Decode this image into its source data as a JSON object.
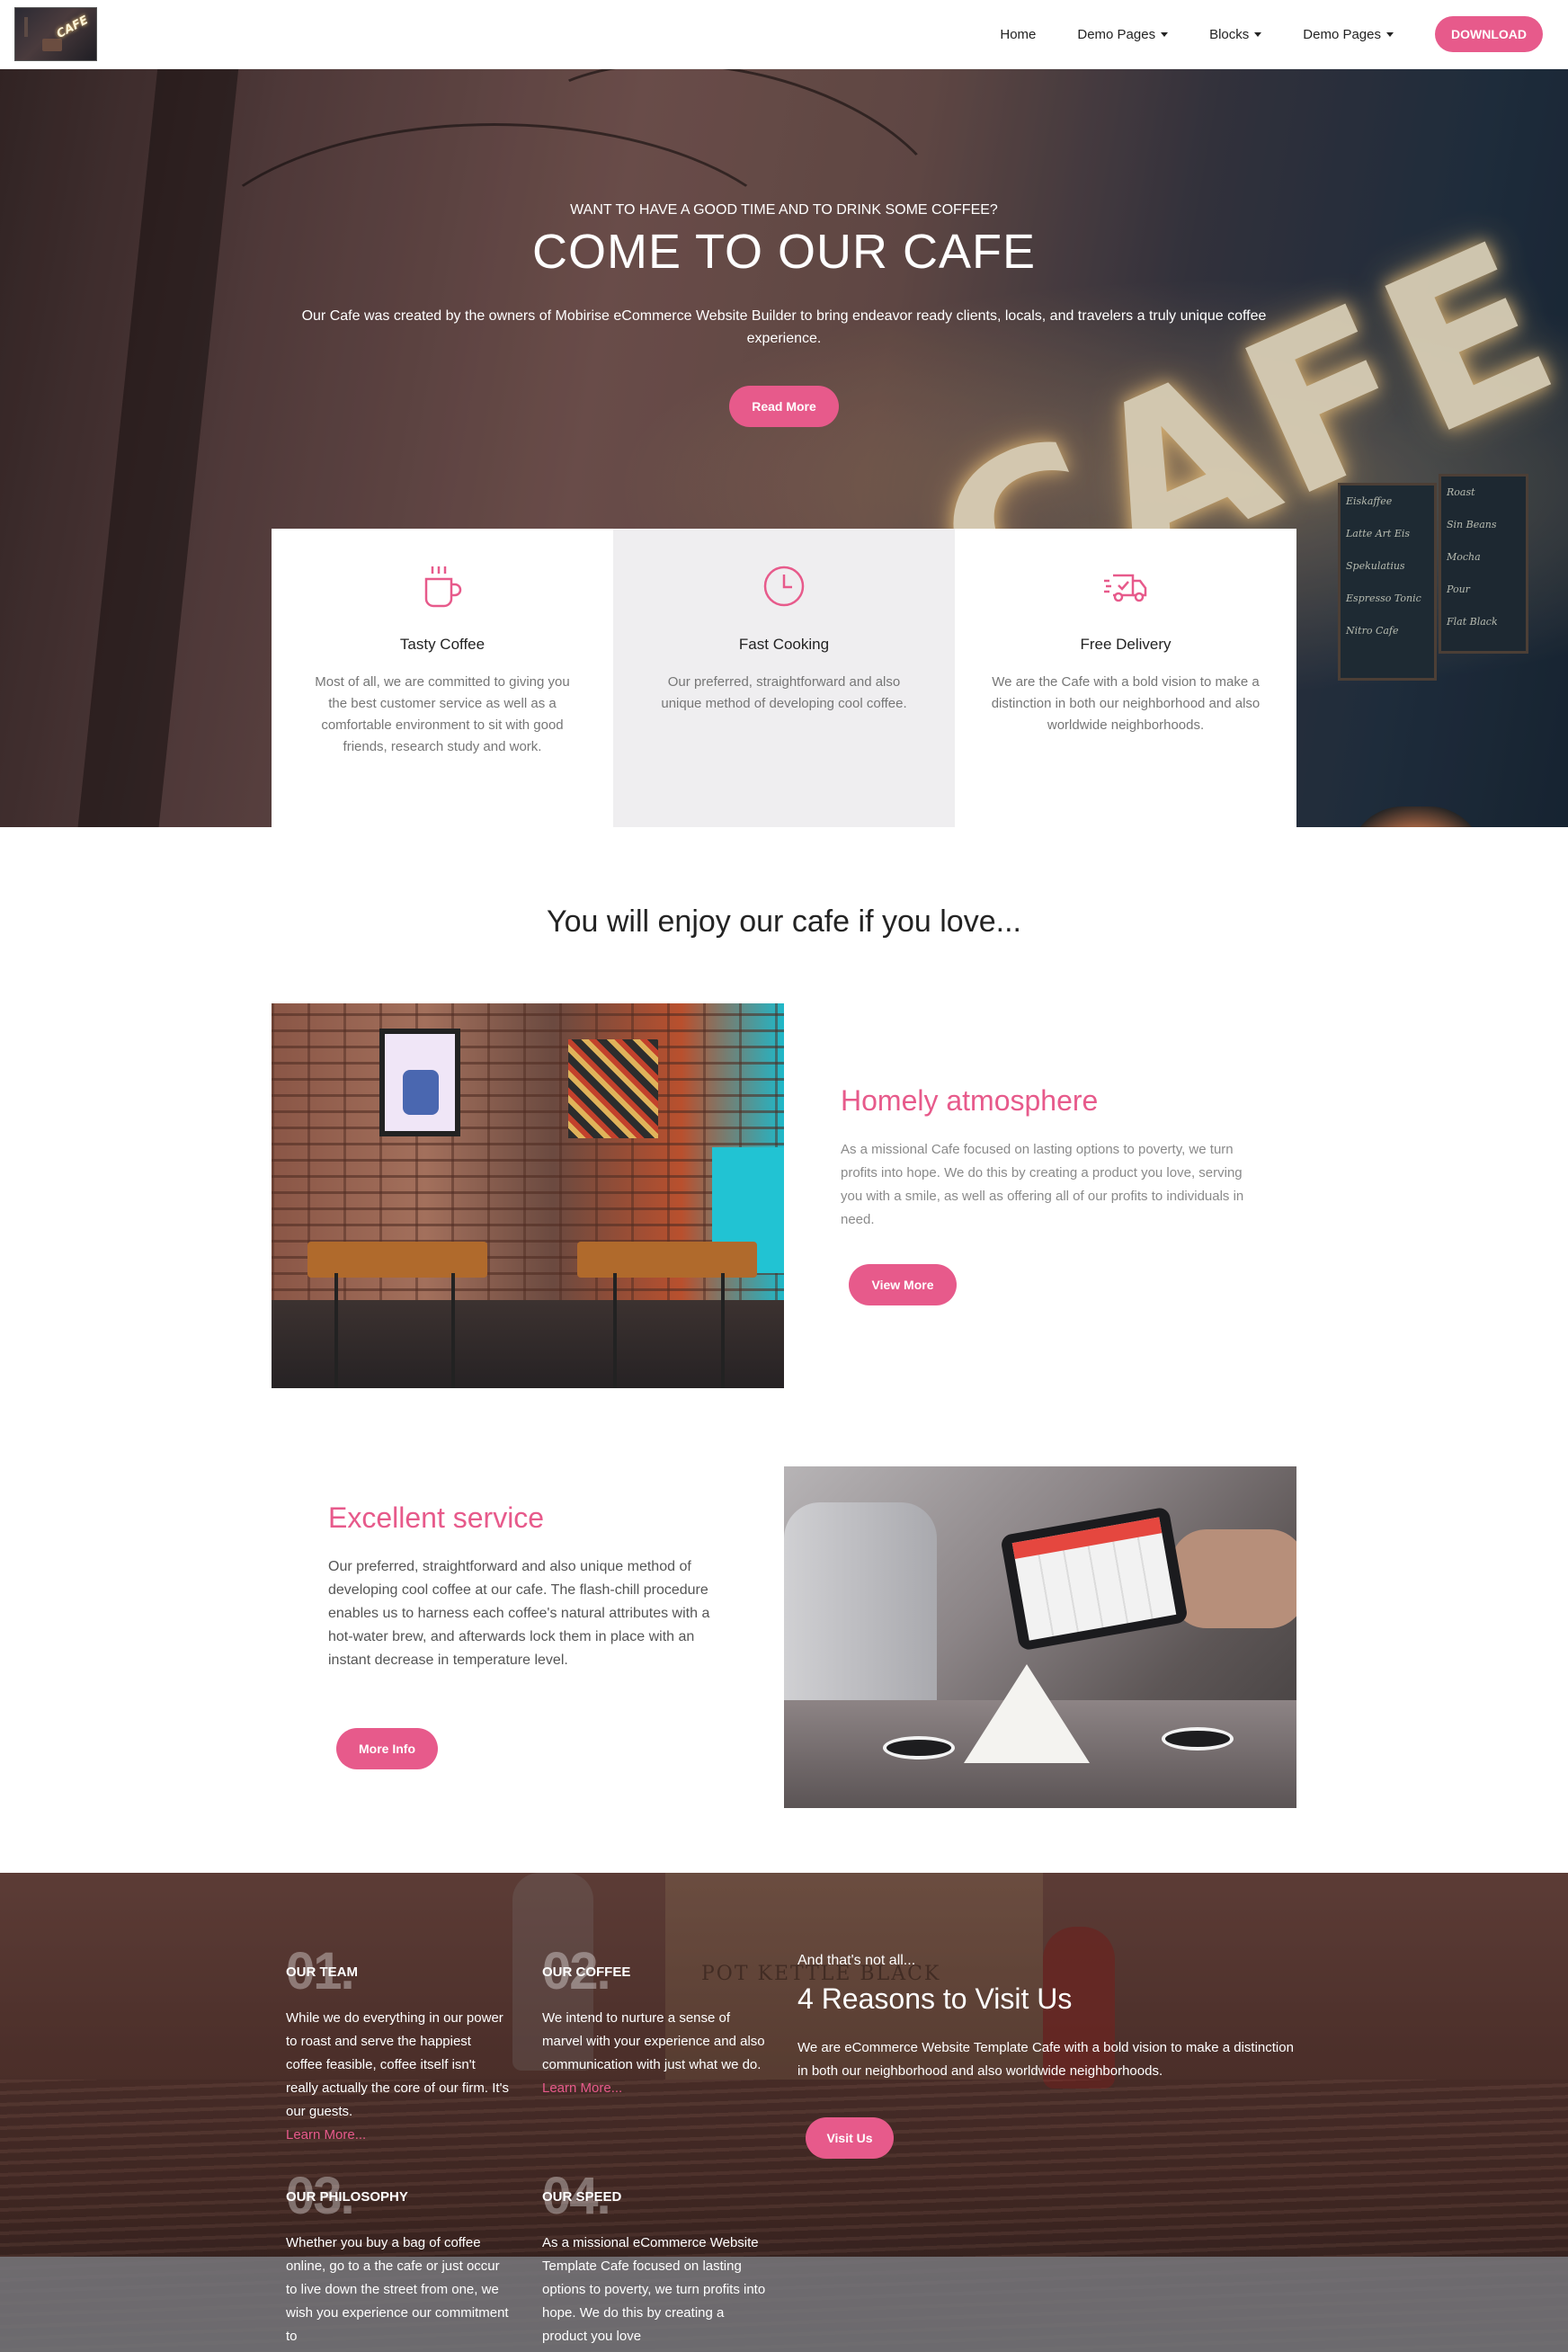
{
  "navbar": {
    "logo_sign": "CAFE",
    "links": [
      {
        "label": "Home"
      },
      {
        "label": "Demo Pages"
      },
      {
        "label": "Blocks"
      },
      {
        "label": "Demo Pages"
      }
    ],
    "download_label": "DOWNLOAD"
  },
  "hero": {
    "subtitle": "WANT TO HAVE A GOOD TIME AND TO DRINK SOME COFFEE?",
    "title": "COME TO OUR CAFE",
    "text": "Our Cafe was created by the owners of Mobirise eCommerce Website Builder to bring endeavor ready clients, locals, and travelers a truly unique coffee experience.",
    "button_label": "Read More",
    "sign_text": "CAFE",
    "board1": [
      "Eiskaffee",
      "Latte Art Eis",
      "Spekulatius",
      "Espresso Tonic",
      "Nitro Cafe"
    ],
    "board2": [
      "Roast",
      "Sin Beans",
      "Mocha",
      "Pour",
      "Flat Black"
    ]
  },
  "features": [
    {
      "icon": "coffee-cup-icon",
      "title": "Tasty Coffee",
      "text": "Most of all, we are committed to giving you the best customer service as well as a comfortable environment to sit with good friends, research study and work."
    },
    {
      "icon": "clock-icon",
      "title": "Fast Cooking",
      "text": "Our preferred, straightforward and also unique method of developing cool coffee."
    },
    {
      "icon": "delivery-truck-icon",
      "title": "Free Delivery",
      "text": "We are the Cafe with a bold vision to make a distinction in both our neighborhood and also worldwide neighborhoods."
    }
  ],
  "section_title": "You will enjoy our cafe if you love...",
  "atmosphere": {
    "title": "Homely atmosphere",
    "text": "As a missional Cafe focused on lasting options to poverty, we turn profits into hope. We do this by creating a product you love, serving you with a smile, as well as offering all of our profits to individuals in need.",
    "button_label": "View More"
  },
  "service": {
    "title": "Excellent service",
    "text": "Our preferred, straightforward and also unique method of developing cool coffee at our cafe. The flash-chill procedure enables us to harness each coffee's natural attributes with a hot-water brew, and afterwards lock them in place with an instant decrease in temperature level.",
    "button_label": "More Info"
  },
  "reasons": {
    "items": [
      {
        "num": "01.",
        "title": "OUR TEAM",
        "text": "While we do everything in our power to roast and serve the happiest coffee feasible, coffee itself isn't really actually the core of our firm. It's our guests.",
        "link": "Learn More..."
      },
      {
        "num": "02.",
        "title": "OUR COFFEE",
        "text": "We intend to nurture a sense of marvel with your experience and also communication with just what we do.",
        "link": "Learn More..."
      },
      {
        "num": "03.",
        "title": "OUR PHILOSOPHY",
        "text": "Whether you buy a bag of coffee online, go to a the cafe or just occur to live down the street from one, we wish you experience our commitment to"
      },
      {
        "num": "04.",
        "title": "OUR SPEED",
        "text": "As a missional eCommerce Website Template Cafe focused on lasting options to poverty, we turn profits into hope. We do this by creating a product you love"
      }
    ],
    "pre_title": "And that's not all...",
    "title": "4 Reasons to Visit Us",
    "text": "We are eCommerce Website Template Cafe with a bold vision to make a distinction in both our neighborhood and also worldwide neighborhoods.",
    "button_label": "Visit Us",
    "crate_text": "POT KETTLE BLACK"
  },
  "colors": {
    "accent": "#e75a8b",
    "text_dark": "#232323",
    "text_muted": "#767676",
    "feature_alt_bg": "#efeef0"
  }
}
